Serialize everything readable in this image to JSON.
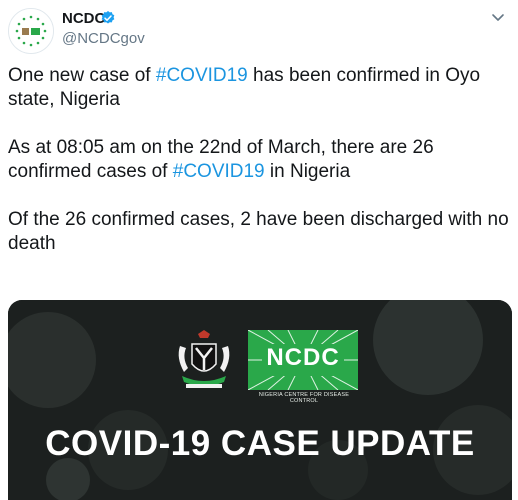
{
  "author": {
    "display_name": "NCDC",
    "handle": "@NCDCgov",
    "verified_icon": "verified-badge-icon",
    "avatar_icon": "ncdc-avatar-logo"
  },
  "tweet": {
    "para1": {
      "before": "One new case of ",
      "hashtag": "#COVID19",
      "after": " has been confirmed in Oyo state, Nigeria"
    },
    "para2": {
      "before": "As at 08:05 am on the 22nd of March, there are 26 confirmed cases of ",
      "hashtag": "#COVID19",
      "after": " in Nigeria"
    },
    "para3": "Of the 26 confirmed cases, 2 have been discharged with no death"
  },
  "media": {
    "logo_text": "NCDC",
    "logo_subtitle": "NIGERIA CENTRE FOR DISEASE CONTROL",
    "headline": "COVID-19 CASE UPDATE"
  },
  "colors": {
    "hashtag": "#1b95e0",
    "verified": "#1da1f2",
    "logo_green": "#2aa84a",
    "media_bg": "#1c201f"
  }
}
